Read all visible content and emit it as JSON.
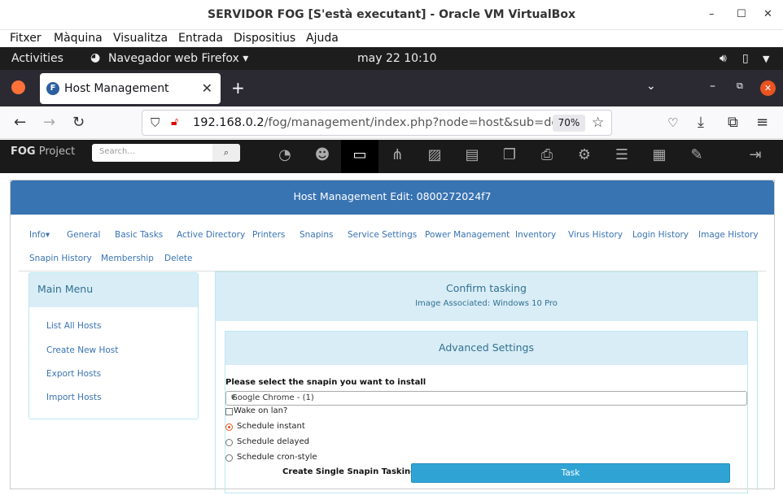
{
  "vbox": {
    "title": "SERVIDOR FOG [S'està executant] - Oracle VM VirtualBox",
    "menu": [
      "Fitxer",
      "Màquina",
      "Visualitza",
      "Entrada",
      "Dispositius",
      "Ajuda"
    ]
  },
  "gnome": {
    "activities": "Activities",
    "app": "Navegador web Firefox ▾",
    "clock": "may 22  10:10"
  },
  "firefox": {
    "tab_title": "Host Management",
    "url_host": "192.168.0.2",
    "url_path": "/fog/management/index.php?node=host&sub=dep",
    "zoom": "70%"
  },
  "fog": {
    "brand_bold": "FOG",
    "brand_rest": " Project",
    "search_placeholder": "Search...",
    "nav_icons": [
      "dashboard-icon",
      "users-icon",
      "hosts-icon",
      "groups-icon",
      "images-icon",
      "storage-icon",
      "snapins-icon",
      "printers-icon",
      "settings-icon",
      "tasks-icon",
      "reports-icon",
      "plugins-icon",
      "logout-icon"
    ]
  },
  "page": {
    "heading": "Host Management Edit: 0800272024f7",
    "tabs_row1": [
      "Info▾",
      "General",
      "Basic Tasks",
      "Active Directory",
      "Printers",
      "Snapins",
      "Service Settings",
      "Power Management",
      "Inventory",
      "Virus History",
      "Login History",
      "Image History"
    ],
    "tabs_row2": [
      "Snapin History",
      "Membership",
      "Delete"
    ],
    "main_menu": {
      "title": "Main Menu",
      "items": [
        "List All Hosts",
        "Create New Host",
        "Export Hosts",
        "Import Hosts"
      ]
    },
    "confirm": {
      "title": "Confirm tasking",
      "subtitle": "Image Associated: Windows 10 Pro"
    },
    "advanced": {
      "title": "Advanced Settings",
      "snapin_label": "Please select the snapin you want to install",
      "snapin_selected": "Google Chrome - (1)",
      "wake_on_lan": "Wake on lan?",
      "schedule_instant": "Schedule instant",
      "schedule_delayed": "Schedule delayed",
      "schedule_cron": "Schedule cron-style",
      "create_label": "Create Single Snapin Tasking",
      "task_button": "Task"
    }
  }
}
